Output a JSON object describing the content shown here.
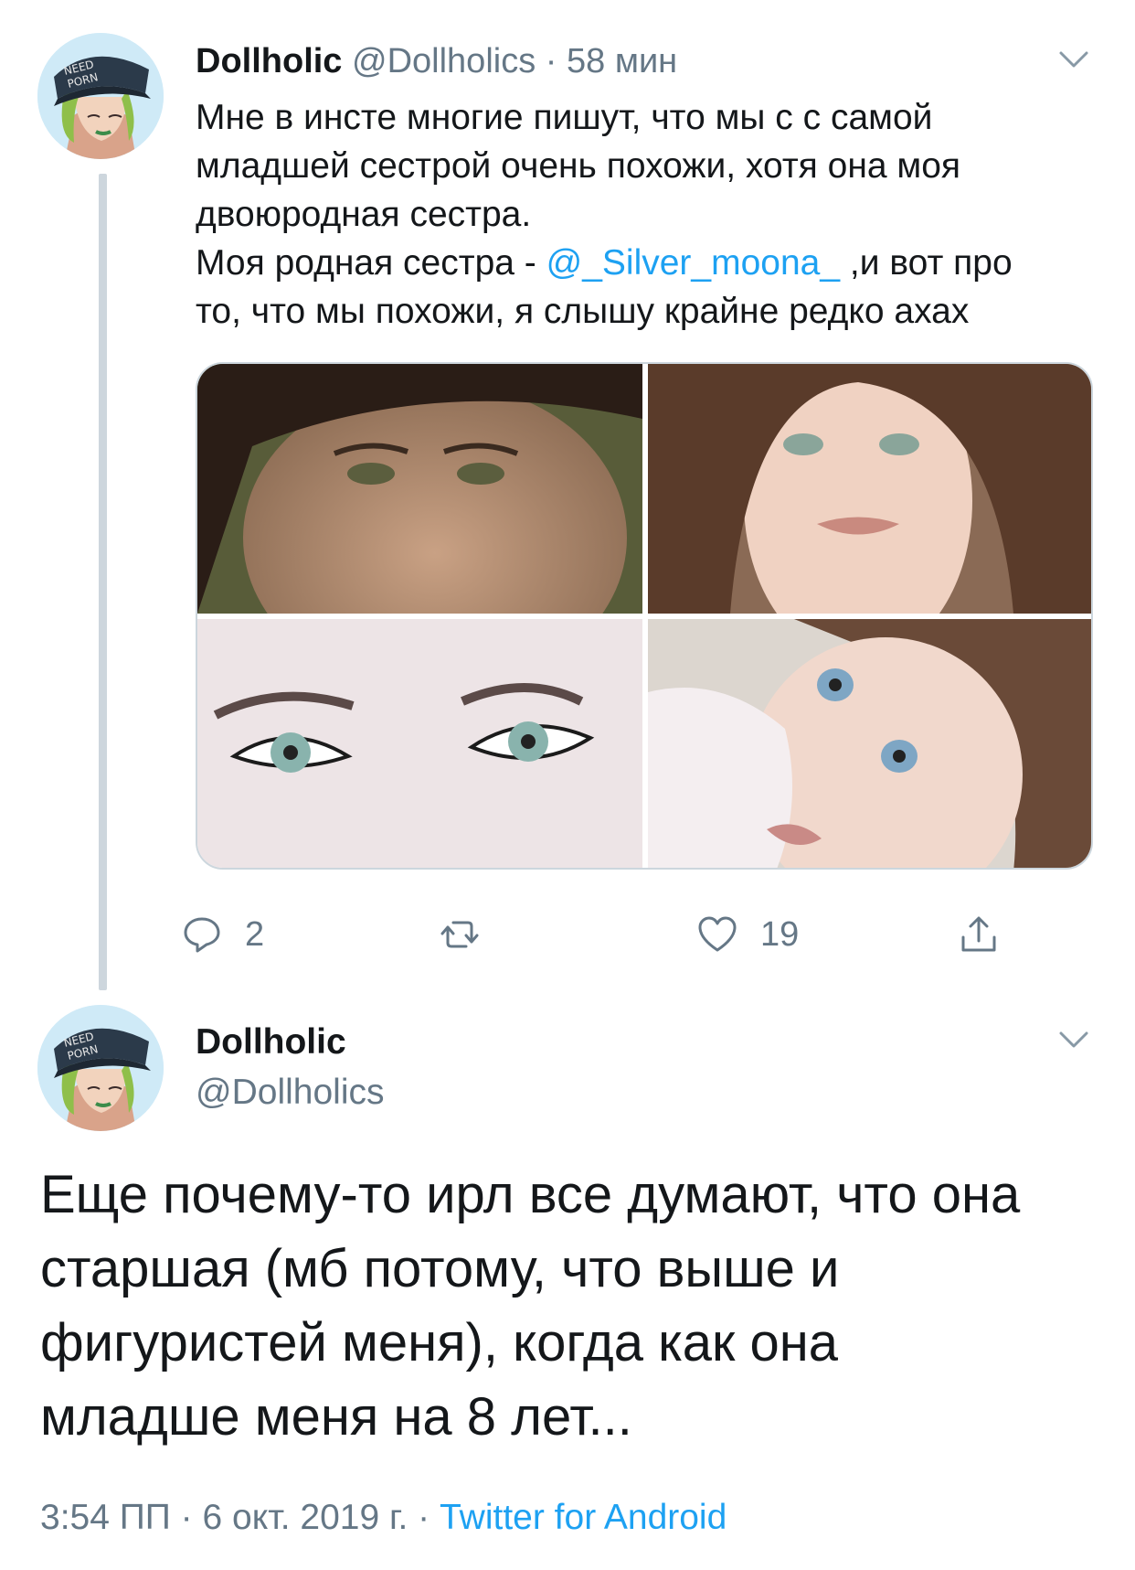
{
  "tweet1": {
    "name": "Dollholic",
    "handle": "@Dollholics",
    "separator": "·",
    "time": "58 мин",
    "text_lines": [
      "Мне в инсте многие пишут, что мы с с самой",
      "младшей сестрой очень похожи, хотя она моя",
      "двоюродная сестра.",
      "Моя родная сестра - "
    ],
    "mention": "@_Silver_moona_",
    "after_mention": " ,и вот про",
    "last_line": "то, что мы похожи, я слышу крайне редко ахах",
    "photos": [
      "photo-1",
      "photo-2",
      "photo-3",
      "photo-4"
    ],
    "actions": {
      "reply_icon": "reply-icon",
      "reply_count": "2",
      "retweet_icon": "retweet-icon",
      "like_icon": "heart-icon",
      "like_count": "19",
      "share_icon": "share-icon"
    }
  },
  "tweet2": {
    "name": "Dollholic",
    "handle": "@Dollholics",
    "text_lines": [
      "Еще почему-то ирл все думают, что она",
      "старшая (мб потому, что выше и",
      "фигуристей меня), когда как она",
      "младше меня на 8 лет..."
    ],
    "time": "3:54 ПП",
    "separator": " · ",
    "date": "6 окт. 2019 г.",
    "source": "Twitter for Android"
  },
  "avatar_text": [
    "NEED",
    "PORN"
  ],
  "colors": {
    "accent": "#1da1f2",
    "secondary_text": "#657786",
    "thread_line": "#cdd6dd"
  }
}
